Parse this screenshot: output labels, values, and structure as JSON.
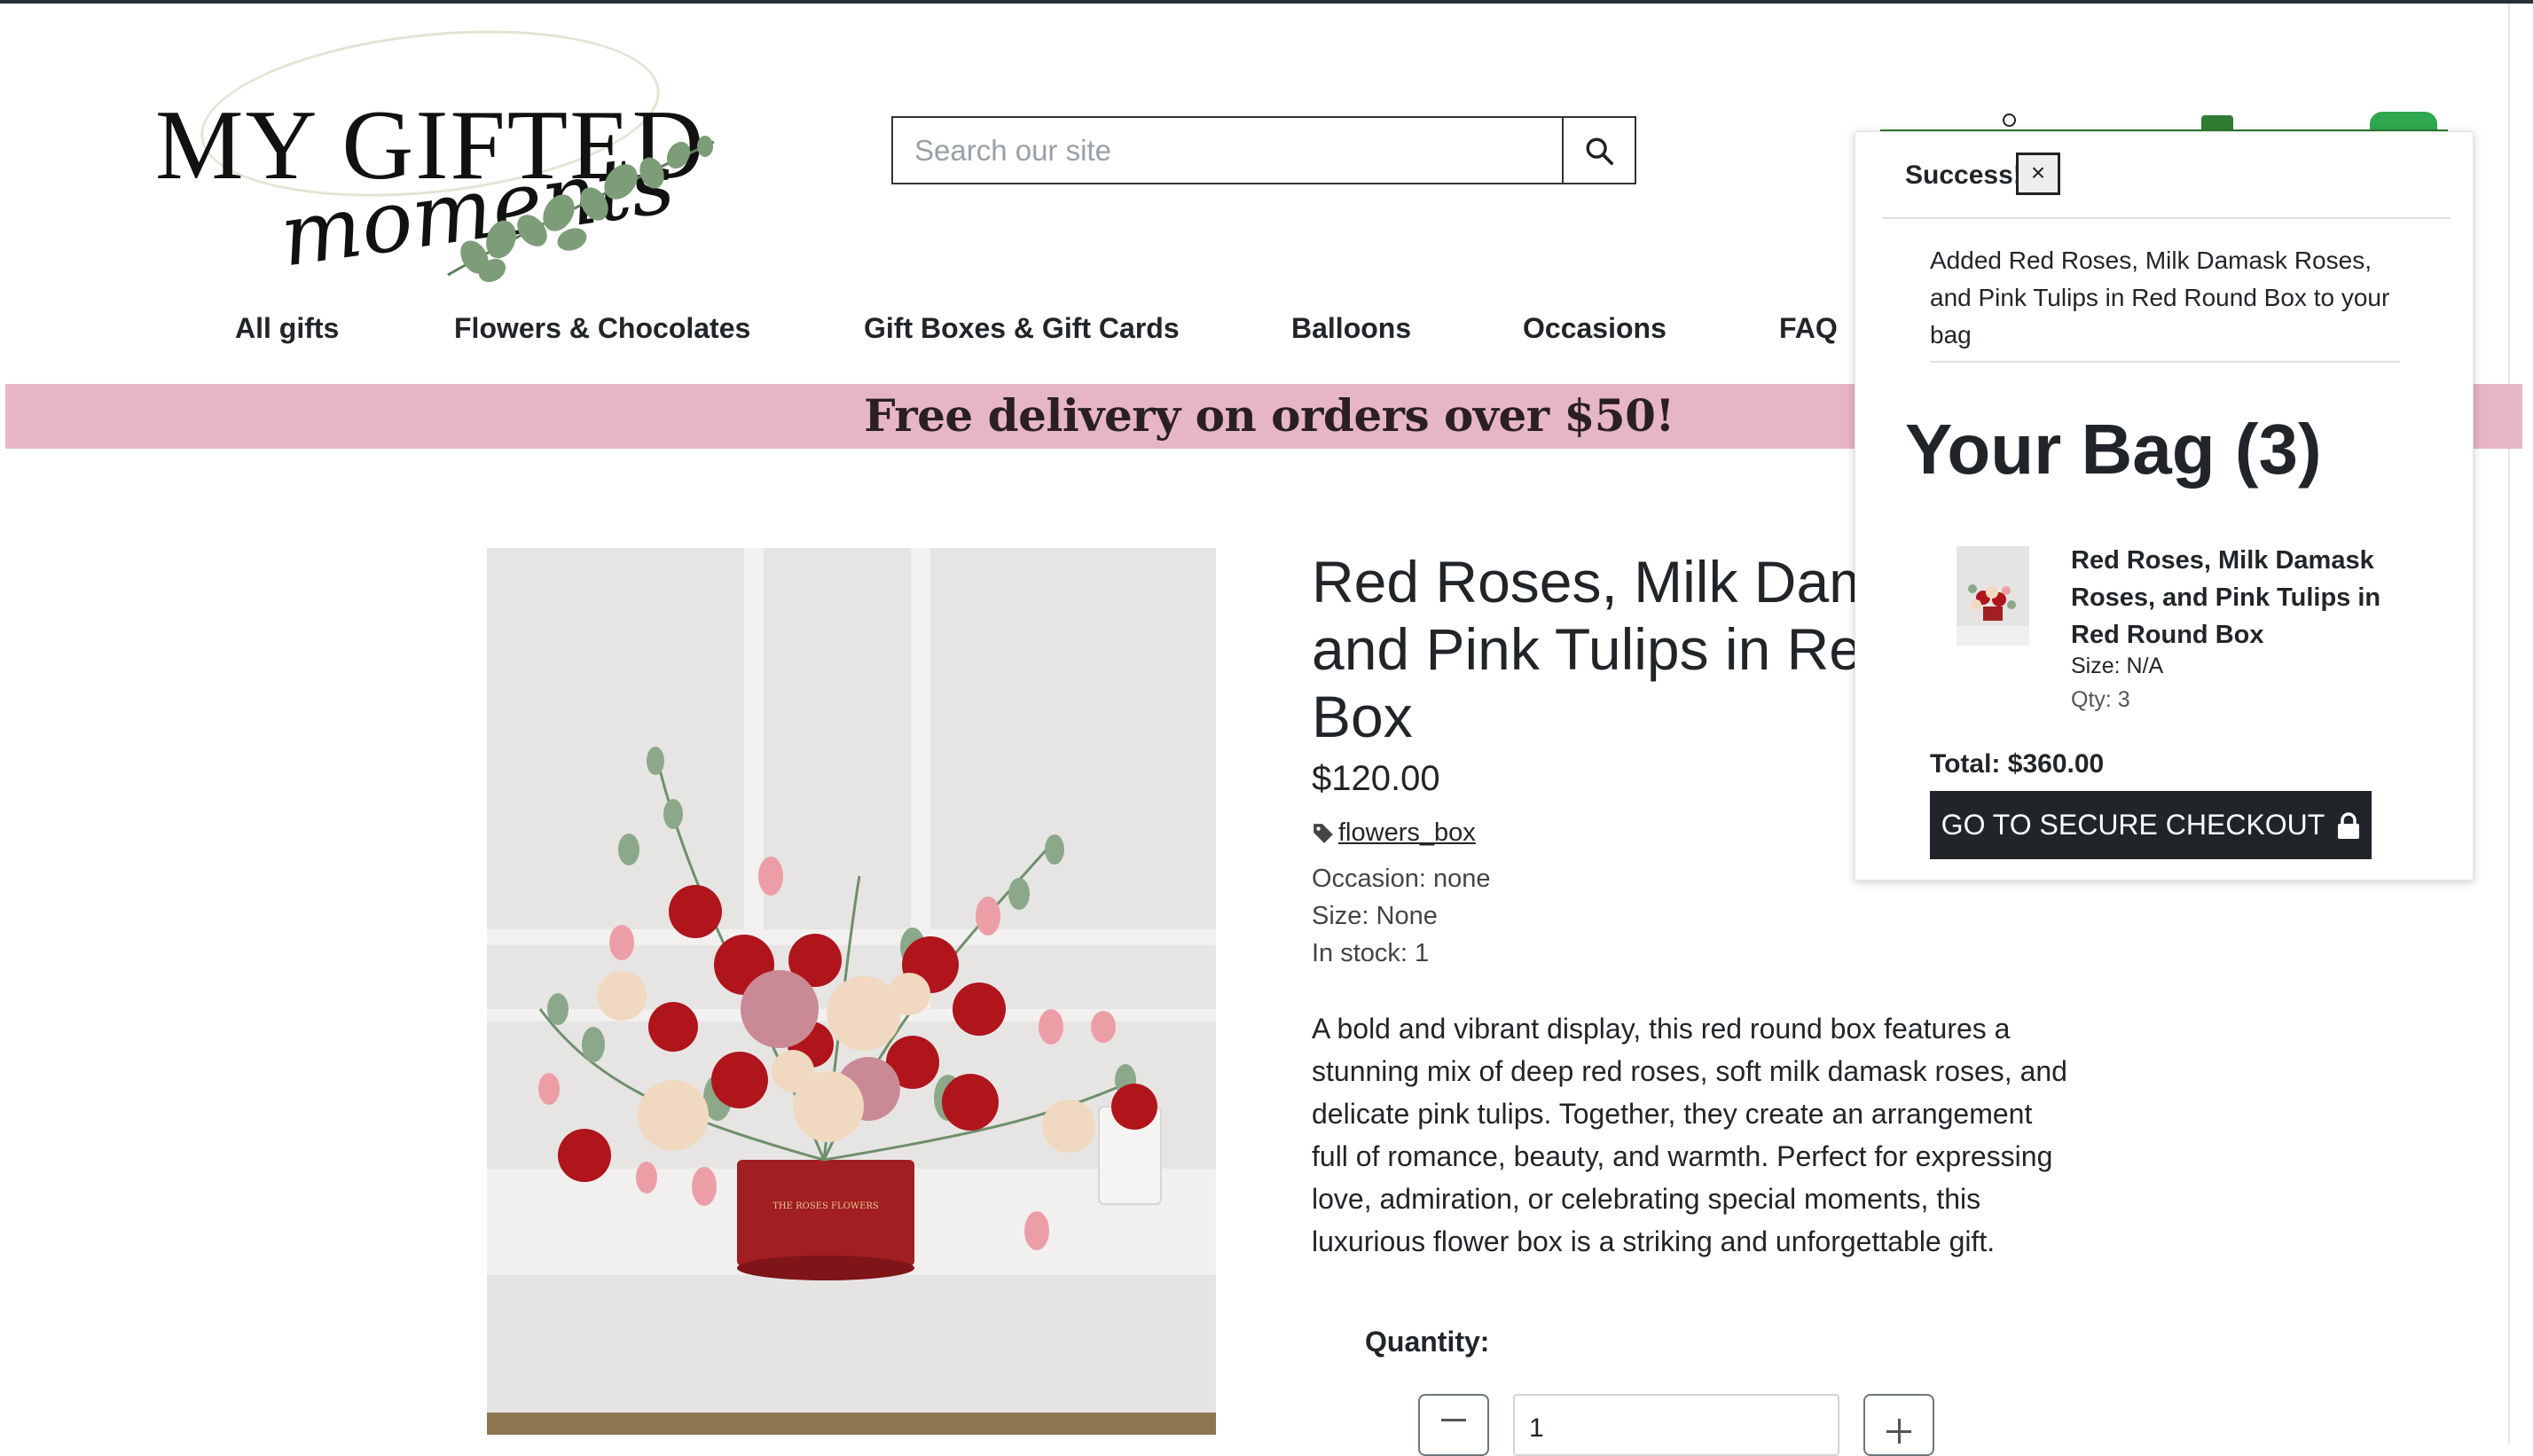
{
  "header": {
    "logo_text_top": "MY GIFTED",
    "logo_text_bottom": "moments",
    "search_placeholder": "Search our site",
    "icons": [
      "search-icon"
    ]
  },
  "nav": {
    "items": [
      "All gifts",
      "Flowers & Chocolates",
      "Gift Boxes & Gift Cards",
      "Balloons",
      "Occasions",
      "FAQ"
    ]
  },
  "banner": {
    "text": "Free delivery on orders over $50!"
  },
  "product": {
    "title": "Red Roses, Milk Damask Roses, and Pink Tulips in Red Round Box",
    "price": "$120.00",
    "tag": "flowers_box",
    "occasion": "Occasion: none",
    "size": "Size: None",
    "stock": "In stock: 1",
    "description": "A bold and vibrant display, this red round box features a stunning mix of deep red roses, soft milk damask roses, and delicate pink tulips. Together, they create an arrangement full of romance, beauty, and warmth. Perfect for expressing love, admiration, or celebrating special moments, this luxurious flower box is a striking and unforgettable gift.",
    "quantity_label": "Quantity:",
    "quantity_value": "1",
    "box_text": "THE ROSES FLOWERS"
  },
  "bag_popup": {
    "success": "Success!",
    "close": "×",
    "added_message": "Added Red Roses, Milk Damask Roses, and Pink Tulips in Red Round Box to your bag",
    "title": "Your Bag (3)",
    "item": {
      "name": "Red Roses, Milk Damask Roses, and Pink Tulips in Red Round Box",
      "size": "Size: N/A",
      "qty": "Qty: 3"
    },
    "total": "Total: $360.00",
    "checkout_label": "GO TO SECURE CHECKOUT"
  },
  "colors": {
    "banner": "#e7b6c5",
    "checkout": "#212529",
    "accent_green": "#2e7d32"
  }
}
